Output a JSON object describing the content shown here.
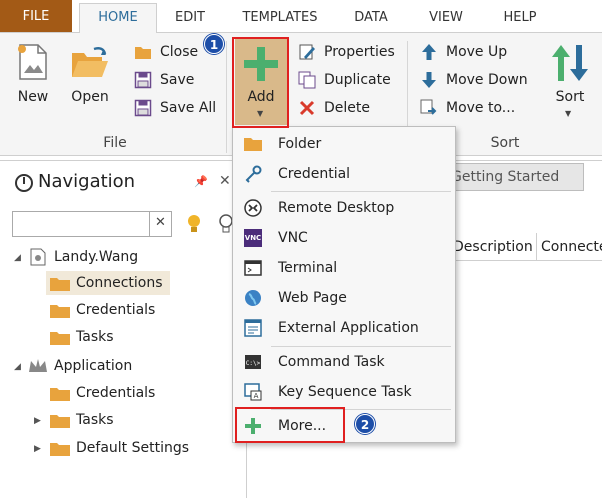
{
  "tabs": [
    "FILE",
    "HOME",
    "EDIT",
    "TEMPLATES",
    "DATA",
    "VIEW",
    "HELP"
  ],
  "ribbon": {
    "new_label": "New",
    "open_label": "Open",
    "close_label": "Close",
    "save_label": "Save",
    "saveall_label": "Save All",
    "file_group": "File",
    "add_label": "Add",
    "properties_label": "Properties",
    "duplicate_label": "Duplicate",
    "delete_label": "Delete",
    "moveup_label": "Move Up",
    "movedown_label": "Move Down",
    "moveto_label": "Move to...",
    "sort_label": "Sort",
    "sort_group": "Sort"
  },
  "navigation": {
    "title": "Navigation",
    "search_value": "",
    "tree": {
      "user": "Landy.Wang",
      "connections": "Connections",
      "credentials1": "Credentials",
      "tasks1": "Tasks",
      "application": "Application",
      "credentials2": "Credentials",
      "tasks2": "Tasks",
      "default_settings": "Default Settings"
    }
  },
  "right": {
    "tab_label": "Getting Started",
    "col_description": "Description",
    "col_connected": "Connecte"
  },
  "menu": {
    "items": [
      "Folder",
      "Credential",
      "Remote Desktop",
      "VNC",
      "Terminal",
      "Web Page",
      "External Application",
      "Command Task",
      "Key Sequence Task",
      "More..."
    ],
    "vnc_icon_text": "VNC"
  },
  "badges": {
    "one": "1",
    "two": "2"
  },
  "colors": {
    "file_tab": "#a35a16",
    "accent_blue": "#2d6d9b",
    "add_green": "#4caf6e",
    "highlight": "#e02020",
    "badge": "#1d4ea8"
  }
}
